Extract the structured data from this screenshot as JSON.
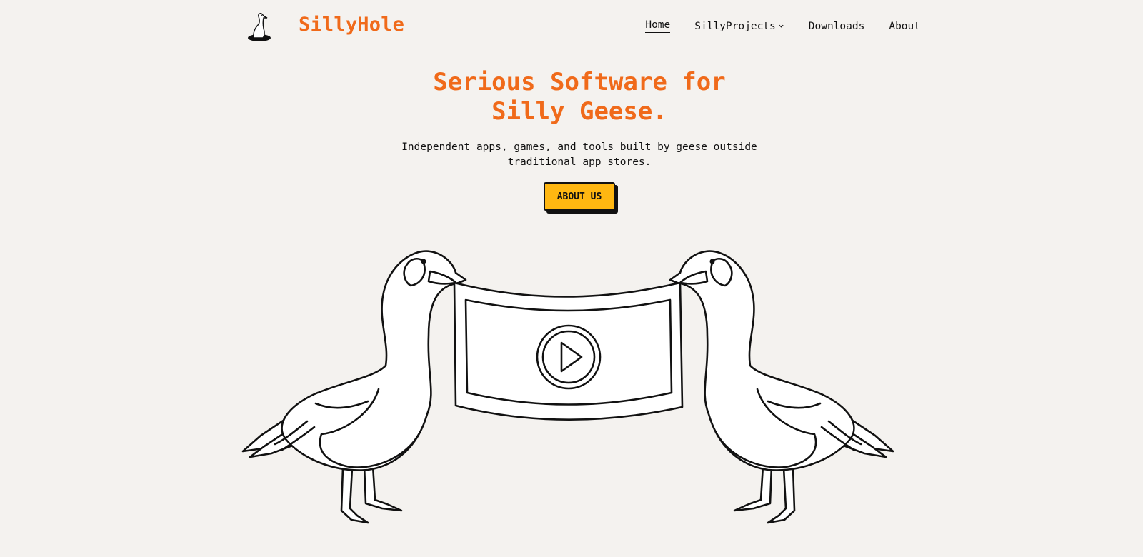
{
  "header": {
    "brand": "SillyHole",
    "nav": [
      {
        "label": "Home",
        "active": true
      },
      {
        "label": "SillyProjects",
        "has_dropdown": true
      },
      {
        "label": "Downloads"
      },
      {
        "label": "About"
      }
    ]
  },
  "hero": {
    "title_line1": "Serious Software for",
    "title_line2": "Silly Geese.",
    "subtitle_line1": "Independent apps, games, and tools built by geese outside",
    "subtitle_line2": "traditional app stores.",
    "cta_label": "ABOUT US"
  },
  "colors": {
    "background": "#f4f2ef",
    "brand_orange": "#f06a1a",
    "cta_yellow": "#ffb711",
    "ink": "#111111"
  },
  "icons": {
    "logo": "goose-in-hole-icon",
    "dropdown": "chevron-down-icon",
    "video": "play-icon"
  }
}
